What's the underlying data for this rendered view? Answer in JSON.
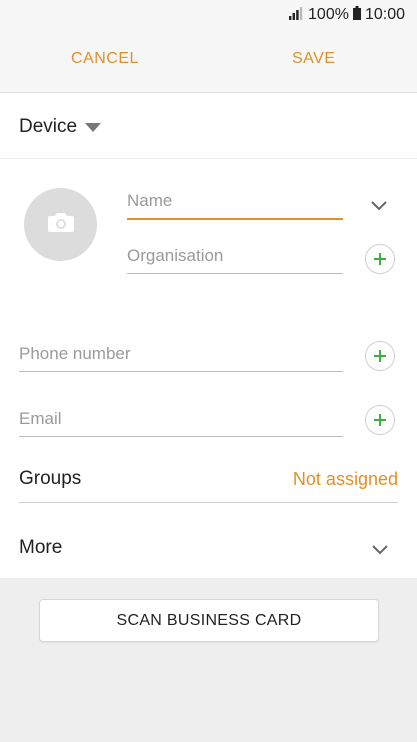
{
  "status_bar": {
    "battery": "100%",
    "time": "10:00"
  },
  "header": {
    "cancel_label": "CANCEL",
    "save_label": "SAVE"
  },
  "storage": {
    "label": "Device"
  },
  "form": {
    "name_placeholder": "Name",
    "organisation_placeholder": "Organisation",
    "phone_placeholder": "Phone number",
    "email_placeholder": "Email"
  },
  "groups": {
    "label": "Groups",
    "value": "Not assigned"
  },
  "more": {
    "label": "More"
  },
  "scan": {
    "label": "SCAN BUSINESS CARD"
  },
  "colors": {
    "accent": "#e0902a",
    "plus": "#3cb043"
  }
}
